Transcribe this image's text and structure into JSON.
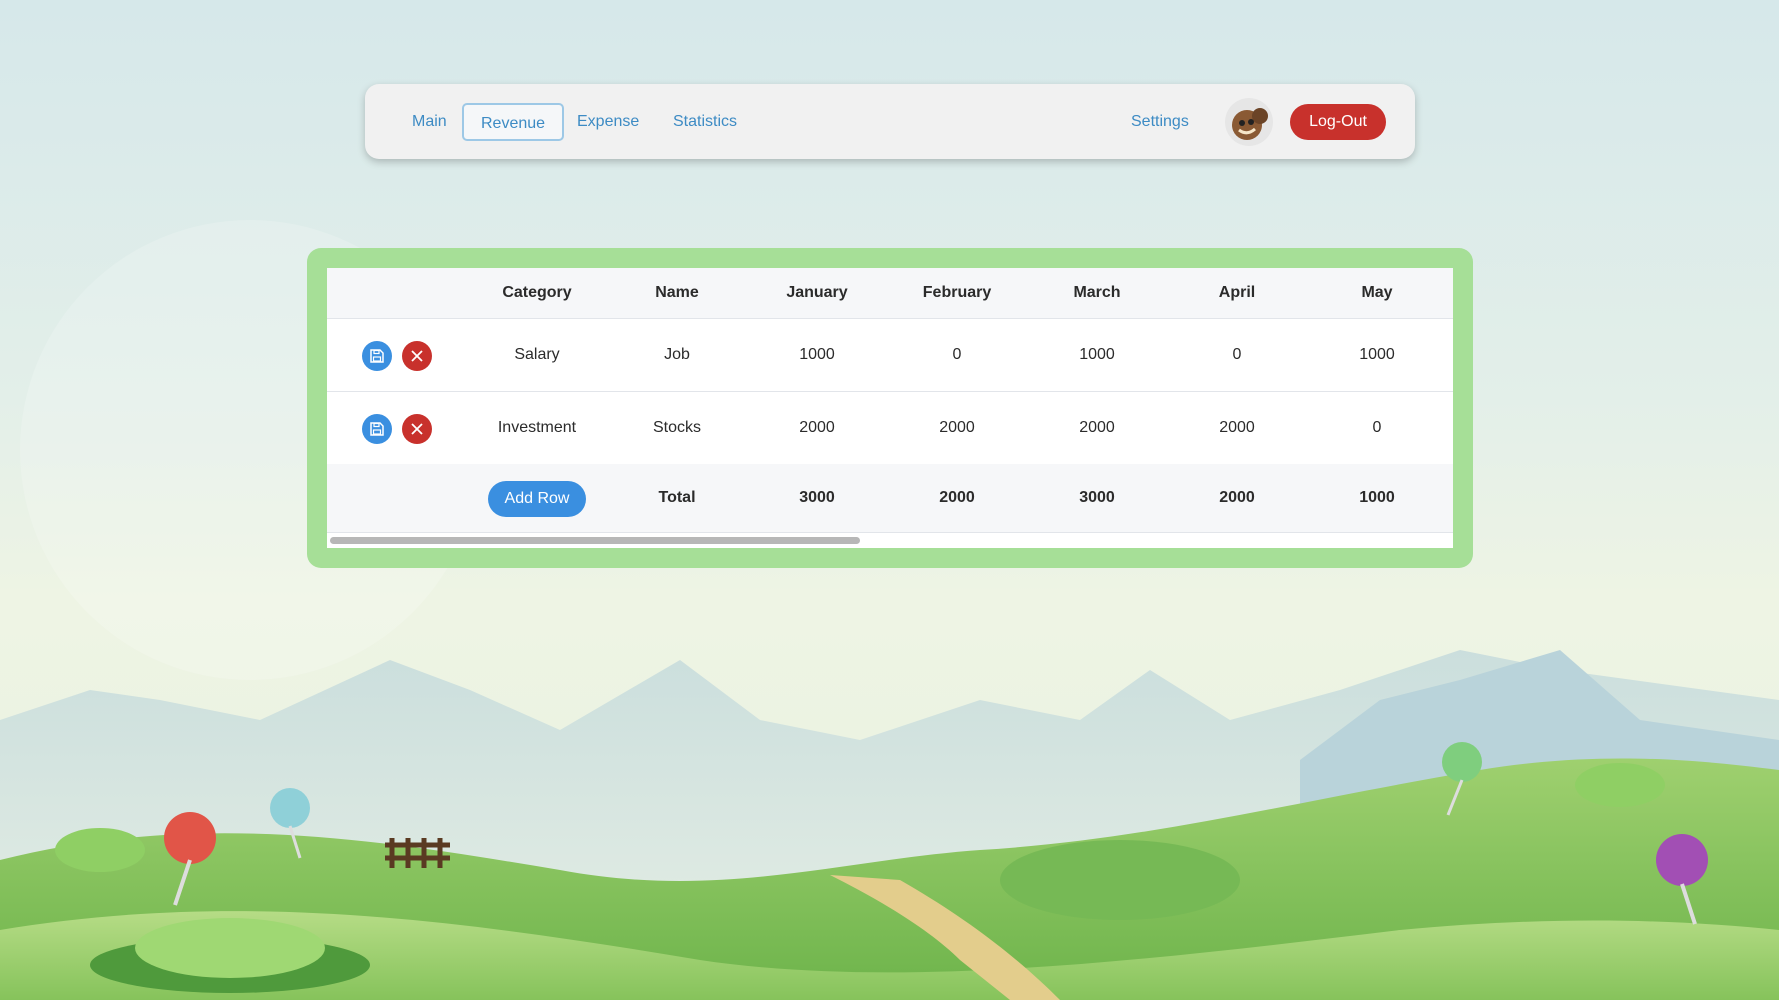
{
  "nav": {
    "links": [
      "Main",
      "Revenue",
      "Expense",
      "Statistics"
    ],
    "active": "Revenue",
    "settings": "Settings",
    "logout": "Log-Out"
  },
  "table": {
    "headers": [
      "",
      "Category",
      "Name",
      "January",
      "February",
      "March",
      "April",
      "May"
    ],
    "rows": [
      {
        "category": "Salary",
        "name": "Job",
        "values": [
          "1000",
          "0",
          "1000",
          "0",
          "1000"
        ]
      },
      {
        "category": "Investment",
        "name": "Stocks",
        "values": [
          "2000",
          "2000",
          "2000",
          "2000",
          "0"
        ]
      }
    ],
    "add_row_label": "Add Row",
    "total_label": "Total",
    "totals": [
      "3000",
      "2000",
      "3000",
      "2000",
      "1000"
    ]
  },
  "colors": {
    "primary": "#3a8fe0",
    "danger": "#c8312c",
    "panel": "#a6df97",
    "link": "#3d8bc4"
  },
  "icons": [
    "save-icon",
    "close-icon",
    "avatar"
  ]
}
